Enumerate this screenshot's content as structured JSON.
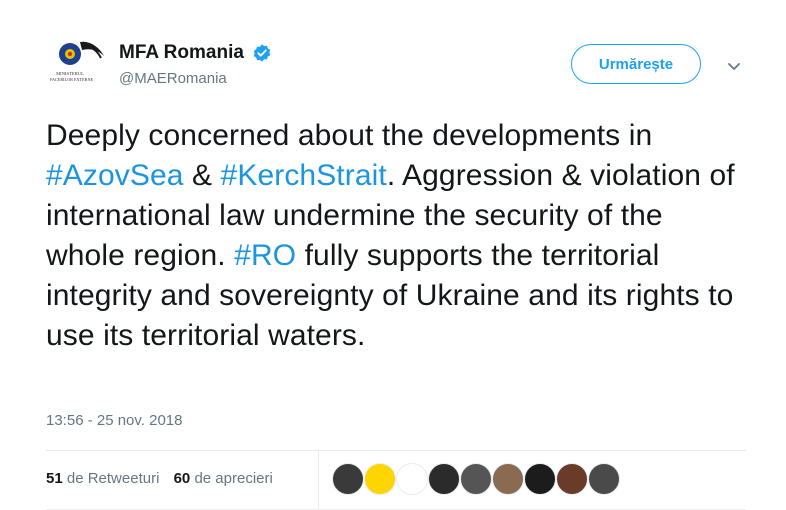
{
  "profile": {
    "display_name": "MFA Romania",
    "handle": "@MAERomania",
    "logo_text_line1": "MINISTERUL",
    "logo_text_line2": "AFACERILOR EXTERNE"
  },
  "follow_button": {
    "label": "Urmărește"
  },
  "tweet": {
    "segments": [
      {
        "text": "Deeply concerned about the developments in ",
        "hashtag": false
      },
      {
        "text": "#AzovSea",
        "hashtag": true
      },
      {
        "text": " & ",
        "hashtag": false
      },
      {
        "text": "#KerchStrait",
        "hashtag": true
      },
      {
        "text": ". Aggression & violation of international law undermine the security of the whole region. ",
        "hashtag": false
      },
      {
        "text": "#RO",
        "hashtag": true
      },
      {
        "text": " fully supports the territorial integrity and sovereignty of Ukraine and its rights to use its territorial waters.",
        "hashtag": false
      }
    ]
  },
  "timestamp": "13:56 - 25 nov. 2018",
  "stats": {
    "retweets_count": "51",
    "retweets_label": "de Retweeturi",
    "likes_count": "60",
    "likes_label": "de aprecieri"
  },
  "likers": [
    {
      "icon": "user-avatar",
      "color": "#3a3a3a"
    },
    {
      "icon": "ukraine-emblem-avatar",
      "color": "#ffd500"
    },
    {
      "icon": "veritas-aequitas-avatar",
      "color": "#ffffff"
    },
    {
      "icon": "user-avatar",
      "color": "#2b2b2b"
    },
    {
      "icon": "user-avatar",
      "color": "#555555"
    },
    {
      "icon": "user-avatar",
      "color": "#8a6a50"
    },
    {
      "icon": "user-avatar",
      "color": "#1c1c1c"
    },
    {
      "icon": "user-avatar",
      "color": "#6b3b2a"
    },
    {
      "icon": "user-avatar",
      "color": "#4a4a4a"
    }
  ],
  "colors": {
    "accent": "#1da1f2",
    "hashtag": "#1b95e0",
    "secondary_text": "#657786"
  }
}
